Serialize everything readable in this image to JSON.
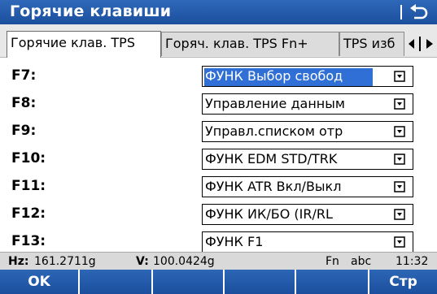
{
  "title": "Горячие клавиши",
  "tabs": [
    "Горячие клав. TPS",
    "Горяч. клав. TPS  Fn+",
    "TPS изб"
  ],
  "rows": [
    {
      "key": "F7:",
      "value": "ФУНК Выбор свобод",
      "selected": true
    },
    {
      "key": "F8:",
      "value": "Управление данным",
      "selected": false
    },
    {
      "key": "F9:",
      "value": "Управл.списком отр",
      "selected": false
    },
    {
      "key": "F10:",
      "value": "ФУНК EDM STD/TRK",
      "selected": false
    },
    {
      "key": "F11:",
      "value": "ФУНК ATR Вкл/Выкл",
      "selected": false
    },
    {
      "key": "F12:",
      "value": "ФУНК ИК/БО (IR/RL",
      "selected": false
    },
    {
      "key": "F13:",
      "value": "ФУНК F1",
      "selected": false
    }
  ],
  "status": {
    "hz_label": "Hz:",
    "hz_value": "161.2711g",
    "v_label": "V:",
    "v_value": "100.0424g",
    "fn": "Fn",
    "input_mode": "abc",
    "time": "11:32"
  },
  "softkeys": [
    "OK",
    "",
    "",
    "",
    "",
    "Стр"
  ]
}
